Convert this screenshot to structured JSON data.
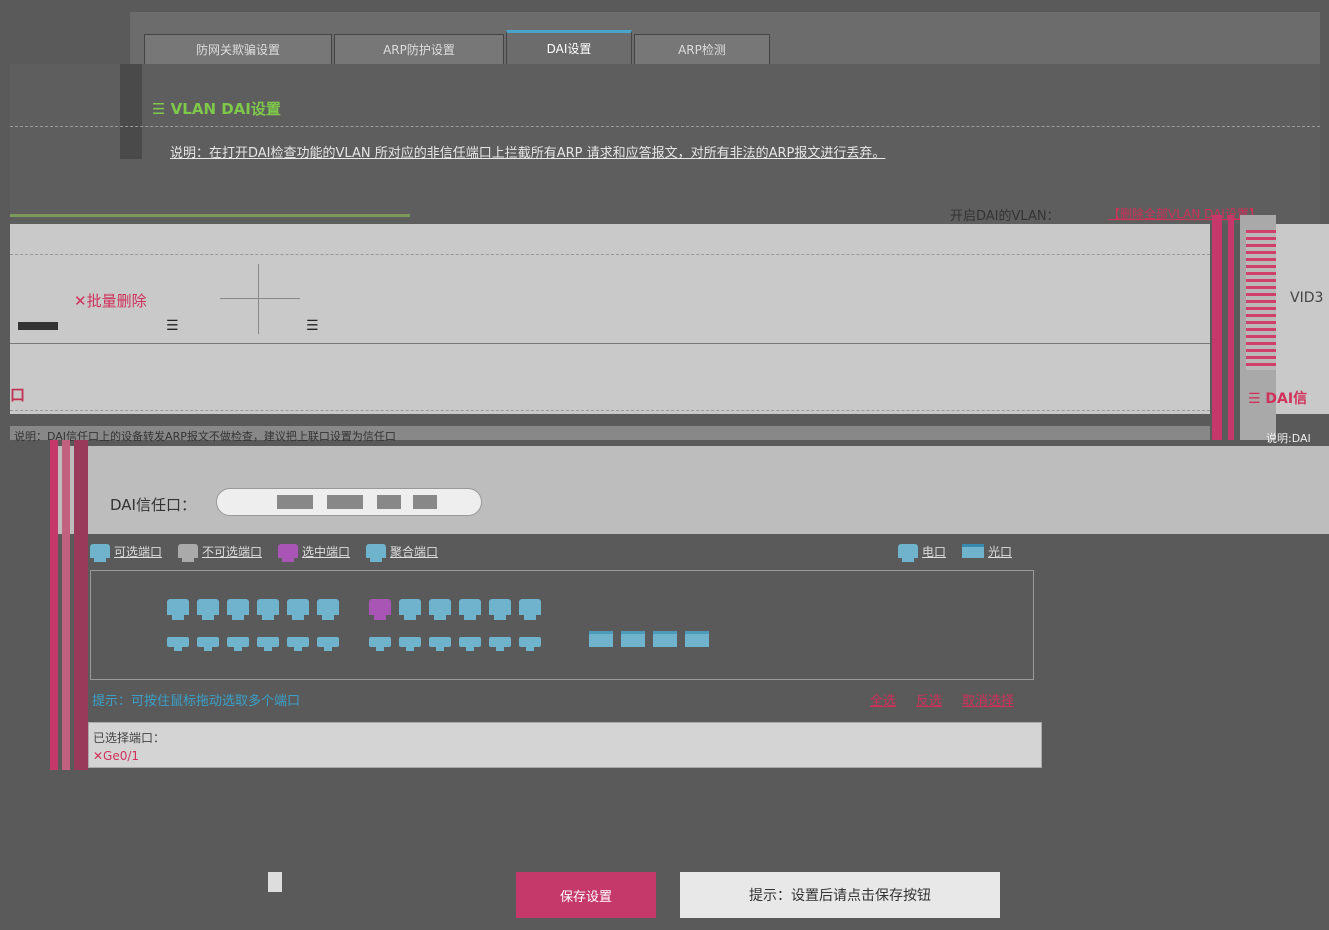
{
  "tabs": [
    {
      "label": "防网关欺骗设置"
    },
    {
      "label": "ARP防护设置"
    },
    {
      "label": "DAI设置"
    },
    {
      "label": "ARP检测"
    }
  ],
  "section": {
    "title": "☰ VLAN DAI设置",
    "description": "说明：在打开DAI检查功能的VLAN 所对应的非信任端口上拦截所有ARP 请求和应答报文，对所有非法的ARP报文进行丢弃。"
  },
  "vlan_toolbar": {
    "enabled_label": "开启DAI的VLAN：",
    "delete_all": "【删除全部VLAN DAI设置】"
  },
  "vlan_panel": {
    "batch_delete": "✕批量删除",
    "vid_label": "VID3"
  },
  "trust_section": {
    "left_fragment": "口",
    "right_fragment": "☰ DAI信",
    "description": "说明：DAI信任口上的设备转发ARP报文不做检查，建议把上联口设置为信任口",
    "right_desc": "说明:DAI"
  },
  "trust_field": {
    "label": "DAI信任口："
  },
  "legend": {
    "available": "可选端口",
    "unavailable": "不可选端口",
    "selected": "选中端口",
    "aggregate": "聚合端口",
    "electric": "电口",
    "fiber": "光口"
  },
  "hint": "提示：可按住鼠标拖动选取多个端口",
  "select_actions": {
    "all": "全选",
    "invert": "反选",
    "cancel": "取消选择"
  },
  "selected_box": {
    "label": "已选择端口：",
    "item": "✕Ge0/1"
  },
  "footer": {
    "save": "保存设置",
    "cancel_text": "提示：设置后请点击保存按钮"
  },
  "colors": {
    "accent_pink": "#c5396a",
    "port_blue": "#6fb3cc",
    "port_selected": "#a855b5",
    "title_green": "#7ec84a"
  }
}
